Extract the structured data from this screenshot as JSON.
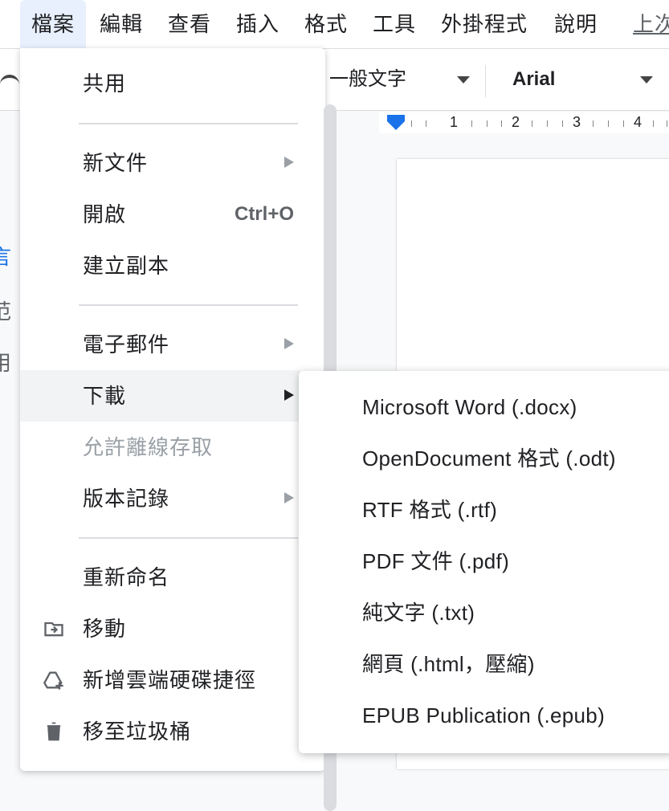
{
  "menubar": {
    "items": [
      "檔案",
      "編輯",
      "查看",
      "插入",
      "格式",
      "工具",
      "外掛程式",
      "說明",
      "上次"
    ]
  },
  "toolbar": {
    "style_select": "一般文字",
    "font_select": "Arial"
  },
  "ruler": {
    "numbers": [
      "1",
      "2",
      "3",
      "4"
    ]
  },
  "outline": {
    "fragments": [
      "言",
      "范",
      "用"
    ]
  },
  "file_menu": {
    "share": "共用",
    "new_document": "新文件",
    "open": "開啟",
    "open_shortcut": "Ctrl+O",
    "make_copy": "建立副本",
    "email": "電子郵件",
    "download": "下載",
    "offline": "允許離線存取",
    "version_history": "版本記錄",
    "rename": "重新命名",
    "move": "移動",
    "add_shortcut": "新增雲端硬碟捷徑",
    "trash": "移至垃圾桶"
  },
  "download_submenu": {
    "items": [
      "Microsoft Word (.docx)",
      "OpenDocument 格式 (.odt)",
      "RTF 格式 (.rtf)",
      "PDF 文件 (.pdf)",
      "純文字 (.txt)",
      "網頁 (.html，壓縮)",
      "EPUB Publication (.epub)"
    ]
  },
  "colors": {
    "accent": "#1a73e8",
    "menu_active_bg": "#e8f0fe",
    "hover_bg": "#f1f3f4"
  }
}
